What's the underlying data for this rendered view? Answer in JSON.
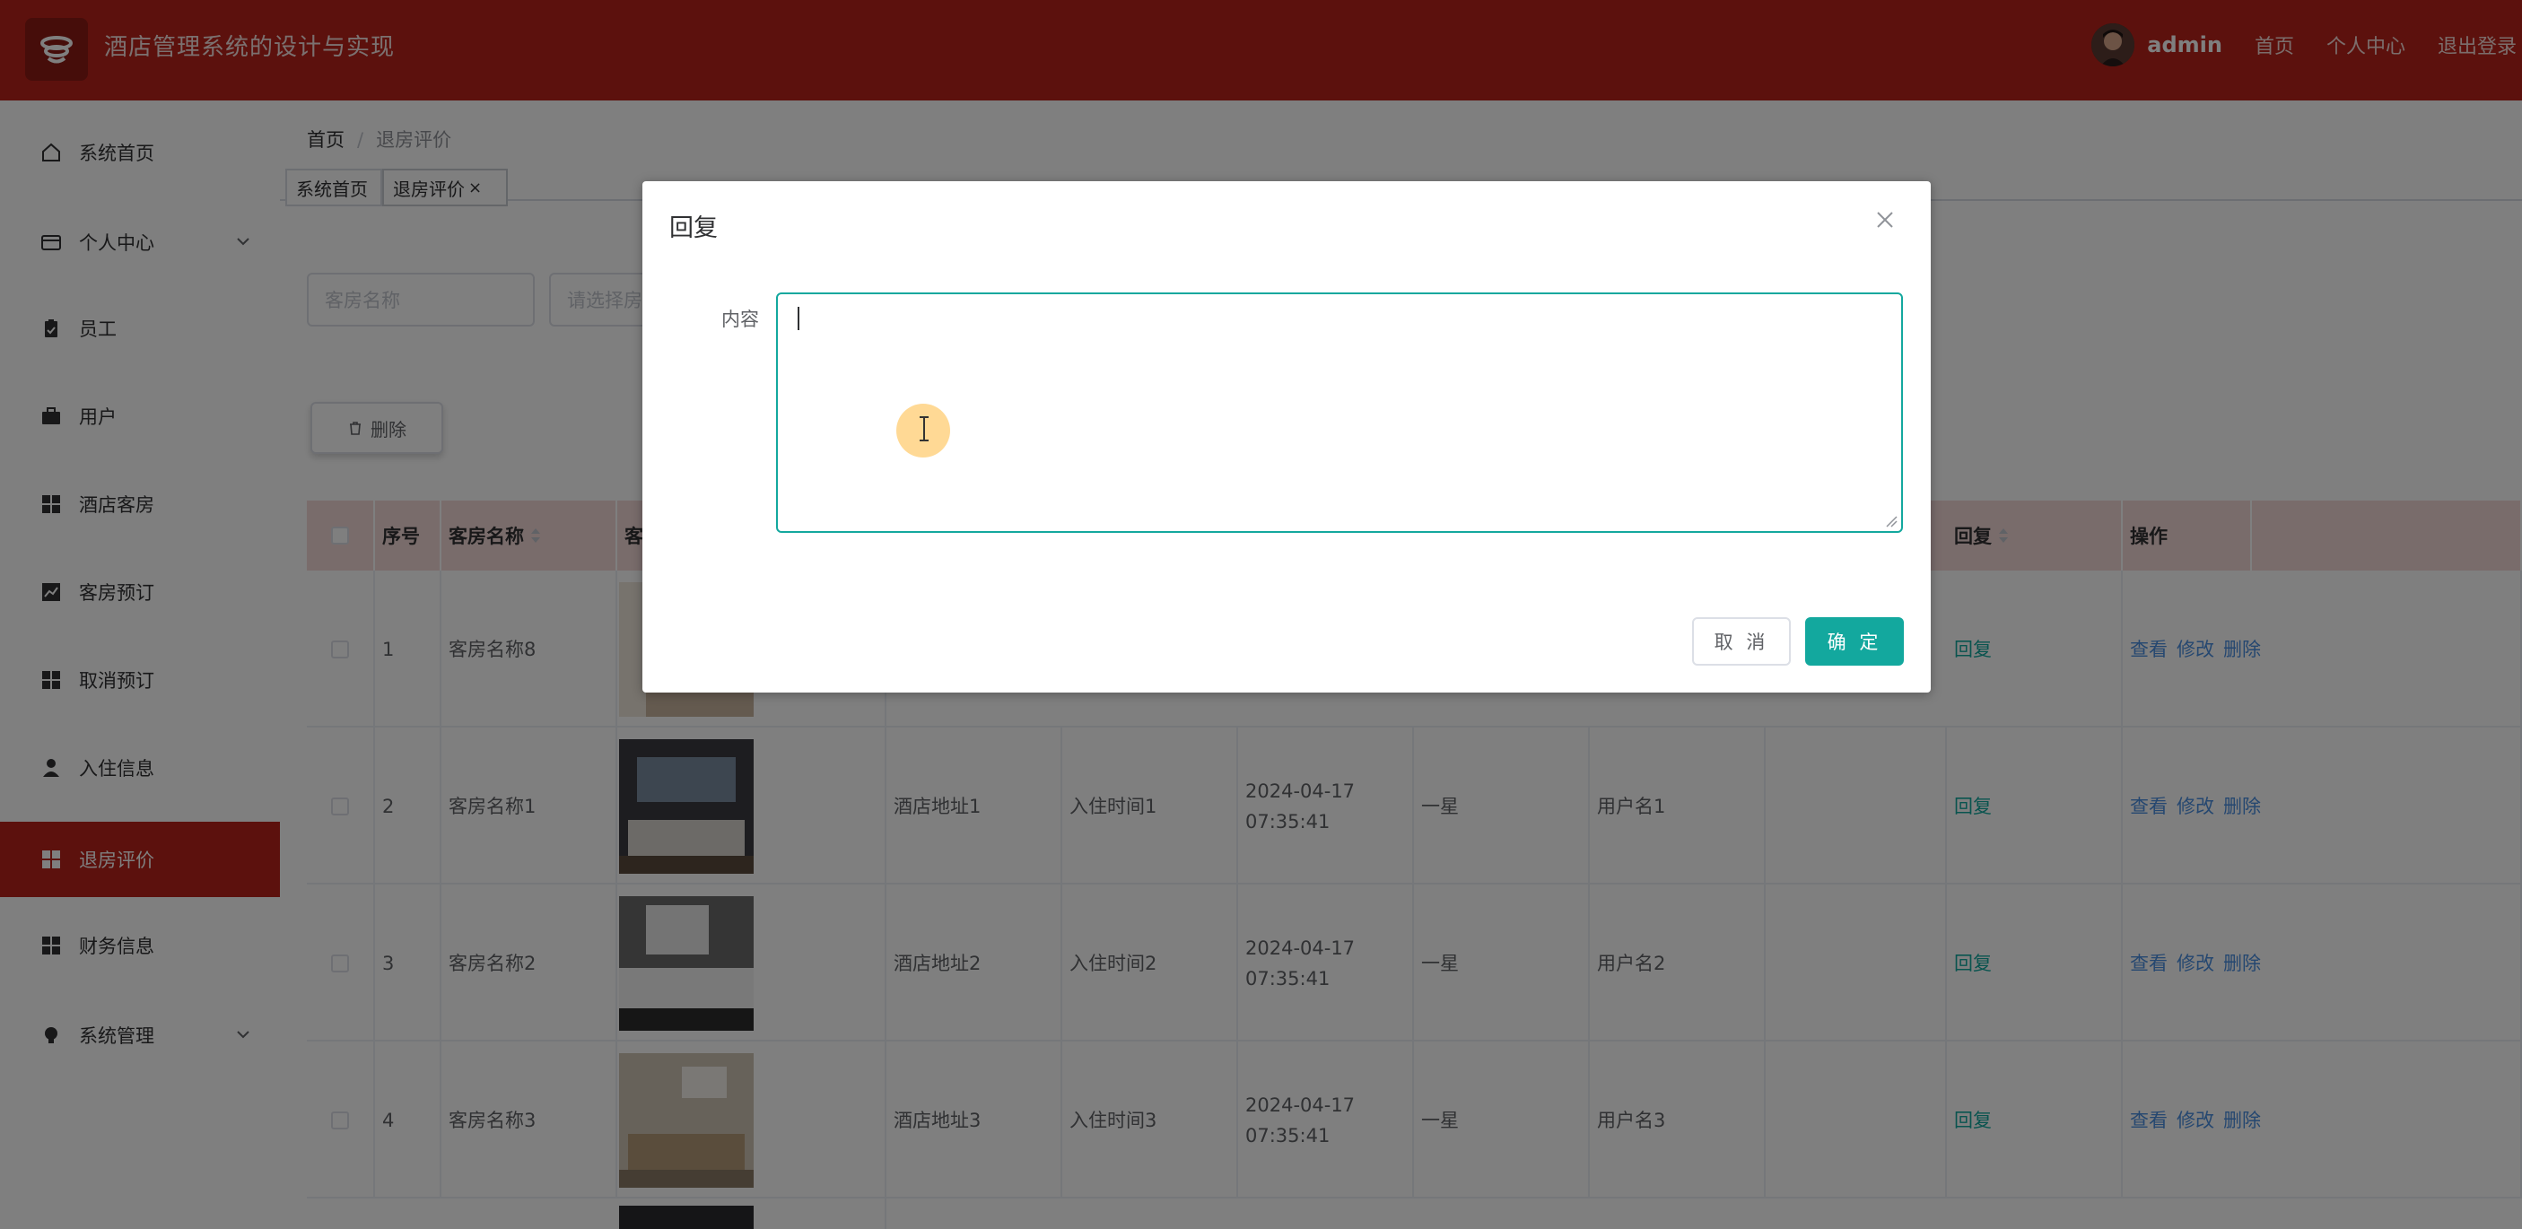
{
  "header": {
    "app_title": "酒店管理系统的设计与实现",
    "username": "admin",
    "links": [
      "首页",
      "个人中心",
      "退出登录"
    ]
  },
  "sidebar": {
    "items": [
      {
        "label": "系统首页",
        "icon": "home-icon"
      },
      {
        "label": "个人中心",
        "icon": "wallet-icon",
        "expandable": true
      },
      {
        "label": "员工",
        "icon": "clipboard-icon"
      },
      {
        "label": "用户",
        "icon": "briefcase-icon"
      },
      {
        "label": "酒店客房",
        "icon": "grid-icon"
      },
      {
        "label": "客房预订",
        "icon": "chart-icon"
      },
      {
        "label": "取消预订",
        "icon": "grid-icon"
      },
      {
        "label": "入住信息",
        "icon": "user-icon"
      },
      {
        "label": "退房评价",
        "icon": "grid-icon",
        "active": true
      },
      {
        "label": "财务信息",
        "icon": "grid-icon"
      },
      {
        "label": "系统管理",
        "icon": "bulb-icon",
        "expandable": true
      }
    ]
  },
  "breadcrumb": {
    "home": "首页",
    "current": "退房评价"
  },
  "tabs": [
    {
      "label": "系统首页"
    },
    {
      "label": "退房评价",
      "closable": true,
      "active": true
    }
  ],
  "filters": {
    "room_name_placeholder": "客房名称",
    "select_placeholder": "请选择房"
  },
  "toolbar": {
    "delete_label": "删除"
  },
  "table": {
    "headers": {
      "index": "序号",
      "room_name": "客房名称",
      "image": "客",
      "reply": "回复",
      "ops": "操作"
    },
    "rows": [
      {
        "index": "1",
        "room_name": "客房名称8",
        "address": "",
        "checkin": "",
        "time": "",
        "rating": "",
        "user": "",
        "reply": "回复"
      },
      {
        "index": "2",
        "room_name": "客房名称1",
        "address": "酒店地址1",
        "checkin": "入住时间1",
        "time": "2024-04-17 07:35:41",
        "rating": "一星",
        "user": "用户名1",
        "reply": "回复"
      },
      {
        "index": "3",
        "room_name": "客房名称2",
        "address": "酒店地址2",
        "checkin": "入住时间2",
        "time": "2024-04-17 07:35:41",
        "rating": "一星",
        "user": "用户名2",
        "reply": "回复"
      },
      {
        "index": "4",
        "room_name": "客房名称3",
        "address": "酒店地址3",
        "checkin": "入住时间3",
        "time": "2024-04-17 07:35:41",
        "rating": "一星",
        "user": "用户名3",
        "reply": "回复"
      }
    ],
    "ops": [
      "查看",
      "修改",
      "删除"
    ]
  },
  "dialog": {
    "title": "回复",
    "field_label": "内容",
    "content_value": "",
    "cancel_label": "取 消",
    "ok_label": "确 定"
  },
  "colors": {
    "brand": "#b8231b",
    "accent": "#13a89e",
    "link": "#4b8fe0"
  }
}
